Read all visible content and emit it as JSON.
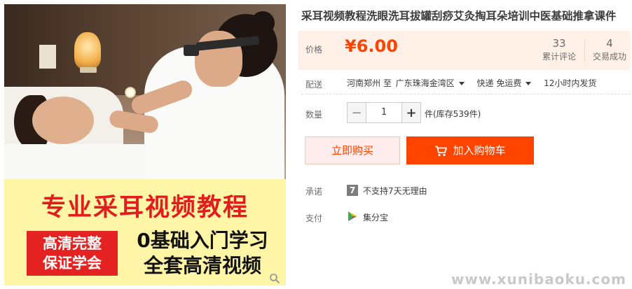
{
  "product": {
    "title": "采耳视频教程洗眼洗耳拔罐刮痧艾灸掏耳朵培训中医基础推拿课件"
  },
  "gallery": {
    "banner_title": "专业采耳视频教程",
    "badge_line1": "高清完整",
    "badge_line2": "保证学会",
    "right_line1": "0基础入门学习",
    "right_line2": "全套高清视频"
  },
  "price": {
    "label": "价格",
    "value": "¥6.00",
    "reviews_count": "33",
    "reviews_label": "累计评论",
    "sold_count": "4",
    "sold_label": "交易成功"
  },
  "shipping": {
    "label": "配送",
    "from": "河南郑州 至",
    "to": "广东珠海金湾区",
    "method": "快递 免运费",
    "dispatch": "12小时内发货"
  },
  "quantity": {
    "label": "数量",
    "value": "1",
    "minus": "−",
    "plus": "+",
    "stock": "件(库存539件)"
  },
  "actions": {
    "buy_now": "立即购买",
    "add_to_cart": "加入购物车"
  },
  "promise": {
    "label": "承诺",
    "icon_text": "7",
    "text": "不支持7天无理由"
  },
  "payment": {
    "label": "支付",
    "text": "集分宝"
  },
  "watermark": "www.xunibaoku.com",
  "colors": {
    "accent": "#ff4400",
    "price_bg": "#fff0e8",
    "banner_bg": "#fef6a6",
    "banner_red": "#e52222"
  }
}
